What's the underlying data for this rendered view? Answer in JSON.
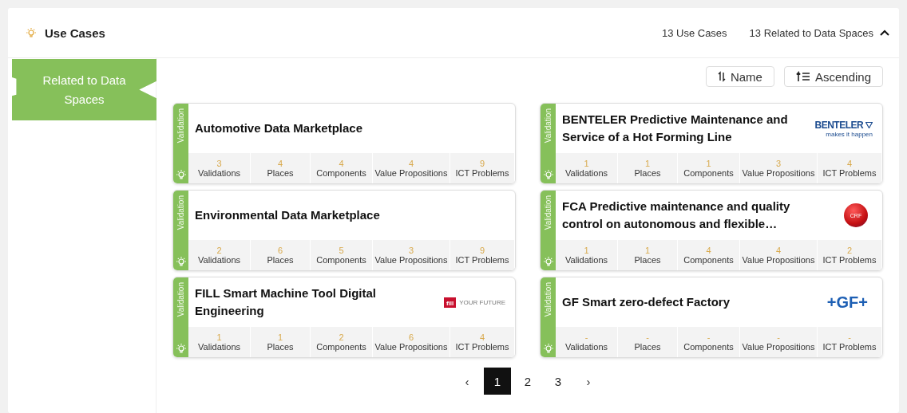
{
  "header": {
    "title": "Use Cases",
    "count": "13 Use Cases",
    "related": "13 Related to Data Spaces",
    "expanded": true
  },
  "sidebar": {
    "items": [
      {
        "label": "Related to Data Spaces",
        "selected": true
      }
    ]
  },
  "sort": {
    "field": "Name",
    "order": "Ascending"
  },
  "cards": [
    {
      "strip": "Validation",
      "title": "Automotive Data Marketplace",
      "stats": [
        {
          "value": "3",
          "label": "Validations"
        },
        {
          "value": "4",
          "label": "Places"
        },
        {
          "value": "4",
          "label": "Components"
        },
        {
          "value": "4",
          "label": "Value Propositions"
        },
        {
          "value": "9",
          "label": "ICT Problems"
        }
      ]
    },
    {
      "strip": "Validation",
      "title": "BENTELER Predictive Maintenance and Service of a Hot Forming Line",
      "logo": {
        "kind": "benteler",
        "text": "BENTELER",
        "tagline": "makes it happen"
      },
      "stats": [
        {
          "value": "1",
          "label": "Validations"
        },
        {
          "value": "1",
          "label": "Places"
        },
        {
          "value": "1",
          "label": "Components"
        },
        {
          "value": "3",
          "label": "Value Propositions"
        },
        {
          "value": "4",
          "label": "ICT Problems"
        }
      ]
    },
    {
      "strip": "Validation",
      "title": "Environmental Data Marketplace",
      "stats": [
        {
          "value": "2",
          "label": "Validations"
        },
        {
          "value": "6",
          "label": "Places"
        },
        {
          "value": "5",
          "label": "Components"
        },
        {
          "value": "3",
          "label": "Value Propositions"
        },
        {
          "value": "9",
          "label": "ICT Problems"
        }
      ]
    },
    {
      "strip": "Validation",
      "title": "FCA Predictive maintenance and quality control on autonomous and flexible…",
      "logo": {
        "kind": "crf",
        "text": "CRF"
      },
      "stats": [
        {
          "value": "1",
          "label": "Validations"
        },
        {
          "value": "1",
          "label": "Places"
        },
        {
          "value": "4",
          "label": "Components"
        },
        {
          "value": "4",
          "label": "Value Propositions"
        },
        {
          "value": "2",
          "label": "ICT Problems"
        }
      ]
    },
    {
      "strip": "Validation",
      "title": "FILL Smart Machine Tool Digital Engineering",
      "logo": {
        "kind": "fill",
        "text": "fill",
        "tagline": "YOUR FUTURE"
      },
      "stats": [
        {
          "value": "1",
          "label": "Validations"
        },
        {
          "value": "1",
          "label": "Places"
        },
        {
          "value": "2",
          "label": "Components"
        },
        {
          "value": "6",
          "label": "Value Propositions"
        },
        {
          "value": "4",
          "label": "ICT Problems"
        }
      ]
    },
    {
      "strip": "Validation",
      "title": "GF Smart zero-defect Factory",
      "logo": {
        "kind": "gf",
        "text": "+GF+"
      },
      "stats": [
        {
          "value": "-",
          "label": "Validations"
        },
        {
          "value": "-",
          "label": "Places"
        },
        {
          "value": "-",
          "label": "Components"
        },
        {
          "value": "-",
          "label": "Value Propositions"
        },
        {
          "value": "-",
          "label": "ICT Problems"
        }
      ]
    }
  ],
  "pagination": {
    "prev": "‹",
    "next": "›",
    "pages": [
      {
        "label": "1",
        "selected": true
      },
      {
        "label": "2",
        "selected": false
      },
      {
        "label": "3",
        "selected": false
      }
    ]
  }
}
